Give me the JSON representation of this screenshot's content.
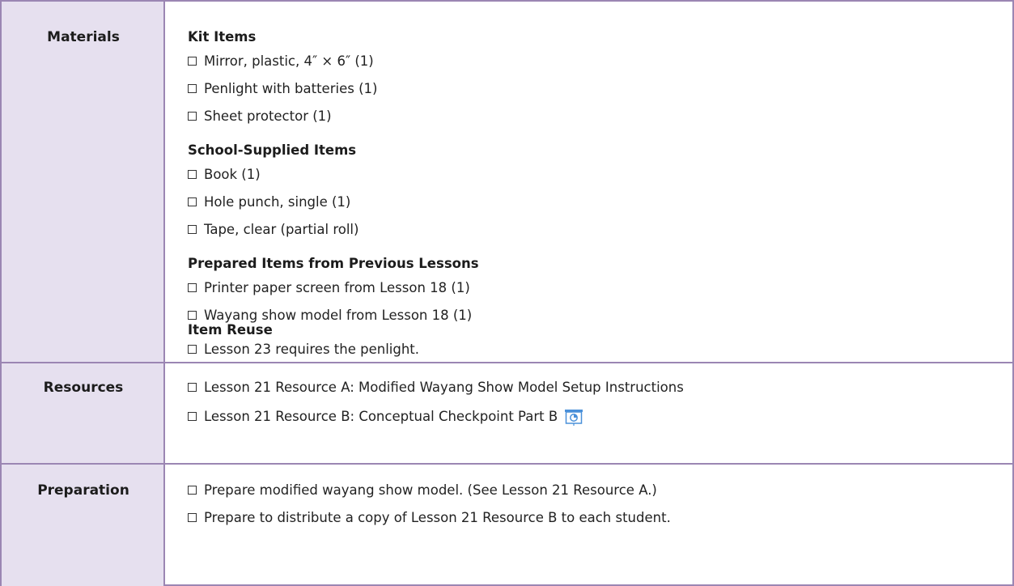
{
  "rows": {
    "materials": {
      "label": "Materials",
      "sections": [
        {
          "heading": "Kit Items",
          "items": [
            "Mirror, plastic, 4″ × 6″ (1)",
            "Penlight with batteries (1)",
            "Sheet protector (1)"
          ]
        },
        {
          "heading": "School-Supplied Items",
          "items": [
            "Book (1)",
            "Hole punch, single (1)",
            "Tape, clear (partial roll)"
          ]
        },
        {
          "heading": "Prepared Items from Previous Lessons",
          "items": [
            "Printer paper screen from Lesson 18 (1)",
            "Wayang show model from Lesson 18 (1)"
          ]
        },
        {
          "heading": "Item Reuse",
          "items": [
            "Lesson 23 requires the penlight."
          ]
        }
      ]
    },
    "resources": {
      "label": "Resources",
      "items": [
        "Lesson 21 Resource A: Modified Wayang Show Model Setup Instructions",
        "Lesson 21 Resource B: Conceptual Checkpoint Part B"
      ],
      "icon": "projection-screen-icon"
    },
    "preparation": {
      "label": "Preparation",
      "items": [
        "Prepare modified wayang show model. (See Lesson 21 Resource A.)",
        "Prepare to distribute a copy of Lesson 21 Resource B to each student."
      ]
    }
  },
  "colors": {
    "border": "#9b86b3",
    "label_bg": "#e6e0ef",
    "icon_blue": "#4a90d9"
  }
}
